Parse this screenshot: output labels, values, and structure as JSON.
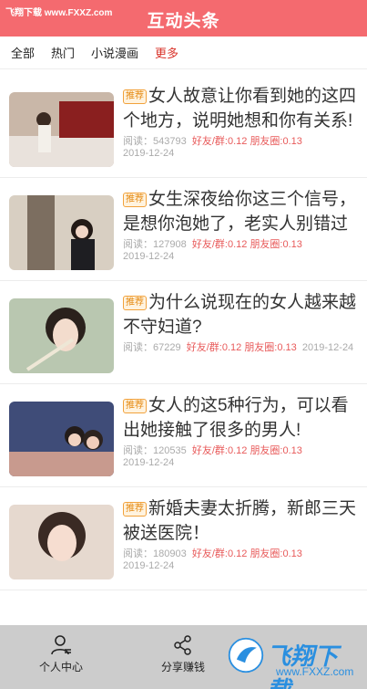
{
  "watermark_top": "飞翔下载 www.FXXZ.com",
  "header": {
    "title": "互动头条"
  },
  "tabs": [
    {
      "label": "全部"
    },
    {
      "label": "热门"
    },
    {
      "label": "小说漫画"
    },
    {
      "label": "更多"
    }
  ],
  "articles": [
    {
      "badge": "推荐",
      "title": "女人故意让你看到她的这四个地方，说明她想和你有关系!",
      "reads_label": "阅读：",
      "reads": "543793",
      "friend": "好友/群:0.12",
      "moments": "朋友圈:0.13",
      "date": "2019-12-24"
    },
    {
      "badge": "推荐",
      "title": "女生深夜给你这三个信号，是想你泡她了，老实人别错过",
      "reads_label": "阅读：",
      "reads": "127908",
      "friend": "好友/群:0.12",
      "moments": "朋友圈:0.13",
      "date": "2019-12-24"
    },
    {
      "badge": "推荐",
      "title": "为什么说现在的女人越来越不守妇道?",
      "reads_label": "阅读：",
      "reads": "67229",
      "friend": "好友/群:0.12",
      "moments": "朋友圈:0.13",
      "date": "2019-12-24"
    },
    {
      "badge": "推荐",
      "title": "女人的这5种行为，可以看出她接触了很多的男人!",
      "reads_label": "阅读：",
      "reads": "120535",
      "friend": "好友/群:0.12",
      "moments": "朋友圈:0.13",
      "date": "2019-12-24"
    },
    {
      "badge": "推荐",
      "title": "新婚夫妻太折腾，新郎三天被送医院！",
      "reads_label": "阅读：",
      "reads": "180903",
      "friend": "好友/群:0.12",
      "moments": "朋友圈:0.13",
      "date": "2019-12-24"
    }
  ],
  "tabbar": [
    {
      "label": "个人中心",
      "icon": "person-icon"
    },
    {
      "label": "分享赚钱",
      "icon": "share-icon"
    }
  ],
  "watermark_br": {
    "brand": "飞翔下载",
    "url": "www.FXXZ.com"
  },
  "colors": {
    "header": "#f46a6f",
    "active_tab": "#d9342b",
    "badge": "#e58a12",
    "earnings": "#e85a5a"
  }
}
